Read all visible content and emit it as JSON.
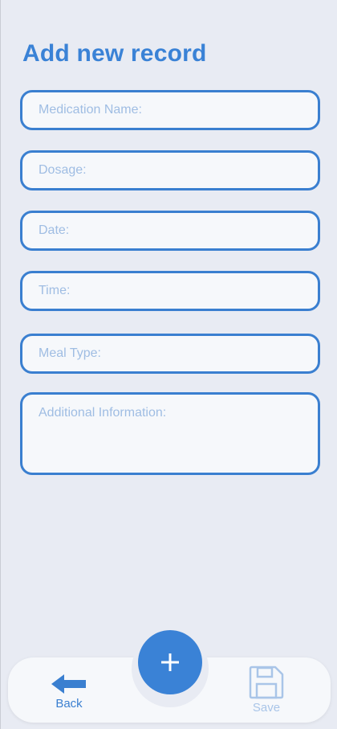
{
  "header": {
    "title": "Add new record"
  },
  "form": {
    "medication_placeholder": "Medication Name:",
    "dosage_placeholder": "Dosage:",
    "date_placeholder": "Date:",
    "time_placeholder": "Time:",
    "meal_type_placeholder": "Meal Type:",
    "additional_info_placeholder": "Additional Information:"
  },
  "nav": {
    "back_label": "Back",
    "back_icon": "arrow-left-icon",
    "add_icon": "plus-icon",
    "save_label": "Save",
    "save_icon": "floppy-disk-icon"
  },
  "colors": {
    "accent": "#3a82d6",
    "field_border": "#3a7fd0",
    "placeholder": "#9fbde3",
    "background": "#e8ebf3",
    "surface": "#f6f8fb",
    "disabled": "#a9c5e8"
  }
}
